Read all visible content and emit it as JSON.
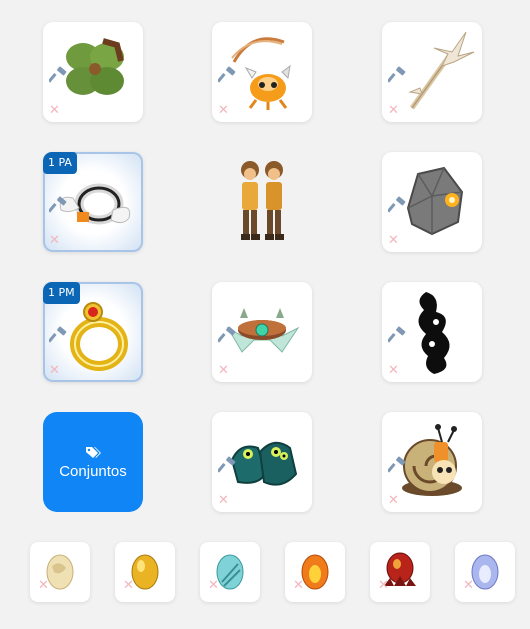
{
  "equipment": {
    "slots": [
      {
        "name": "trophy-slot",
        "item": "clover-shield-icon"
      },
      {
        "name": "amulet-slot",
        "item": "crab-amulet-icon"
      },
      {
        "name": "weapon-slot",
        "item": "crystal-staff-icon"
      },
      {
        "name": "ring-left-slot",
        "item": "winged-ring-icon",
        "badge": "1 PA"
      },
      {
        "name": "character-preview",
        "item": "character-duo-icon"
      },
      {
        "name": "hat-slot",
        "item": "stone-helmet-icon"
      },
      {
        "name": "ring-right-slot",
        "item": "ruby-ring-icon",
        "badge": "1 PM"
      },
      {
        "name": "belt-slot",
        "item": "leaf-belt-icon"
      },
      {
        "name": "cape-slot",
        "item": "ink-cape-icon"
      },
      {
        "name": "boots-slot",
        "item": "frog-boots-icon"
      },
      {
        "name": "pet-slot",
        "item": "snail-pet-icon"
      }
    ],
    "sets_button": {
      "label": "Conjuntos",
      "icon": "tags-icon"
    },
    "dofus": [
      {
        "name": "dofus-slot-1",
        "item": "cream-dofus-icon",
        "color": "#efe1b4"
      },
      {
        "name": "dofus-slot-2",
        "item": "amber-dofus-icon",
        "color": "#e9b324"
      },
      {
        "name": "dofus-slot-3",
        "item": "turquoise-dofus-icon",
        "color": "#7fd3d6"
      },
      {
        "name": "dofus-slot-4",
        "item": "fire-dofus-icon",
        "color": "#f07b1a"
      },
      {
        "name": "dofus-slot-5",
        "item": "crimson-dofus-icon",
        "color": "#b8231a"
      },
      {
        "name": "dofus-slot-6",
        "item": "crystal-dofus-icon",
        "color": "#aab6ee"
      }
    ],
    "colors": {
      "accent": "#1085f5",
      "badge": "#0b67b6",
      "remove": "#f2b6bd",
      "hammer": "#7f98b5"
    }
  }
}
